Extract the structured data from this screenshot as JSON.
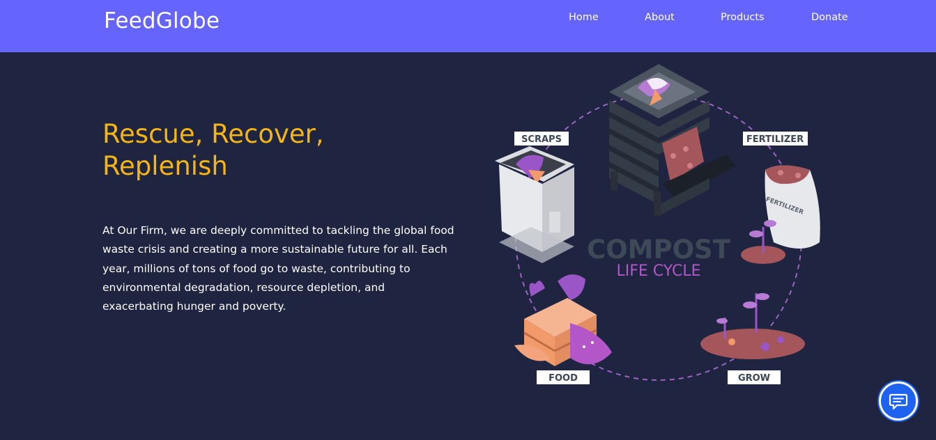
{
  "brand": "FeedGlobe",
  "nav": {
    "home": "Home",
    "about": "About",
    "products": "Products",
    "donate": "Donate"
  },
  "hero": {
    "headline_line1": "Rescue, Recover,",
    "headline_line2": "Replenish",
    "paragraph": "At Our Firm, we are deeply committed to tackling the global food waste crisis and creating a more sustainable future for all. Each year, millions of tons of food go to waste, contributing to environmental degradation, resource depletion, and exacerbating hunger and poverty."
  },
  "illustration": {
    "title": "COMPOST",
    "subtitle": "LIFE CYCLE",
    "labels": {
      "scraps": "SCRAPS",
      "fertilizer": "FERTILIZER",
      "food": "FOOD",
      "grow": "GROW"
    },
    "bag_text": "FERTILIZER"
  },
  "colors": {
    "navbar": "#6565fe",
    "background": "#1f2541",
    "accent": "#f5b512",
    "chat_button": "#1d63ef"
  },
  "icons": {
    "chat": "chat-bubble-icon"
  }
}
